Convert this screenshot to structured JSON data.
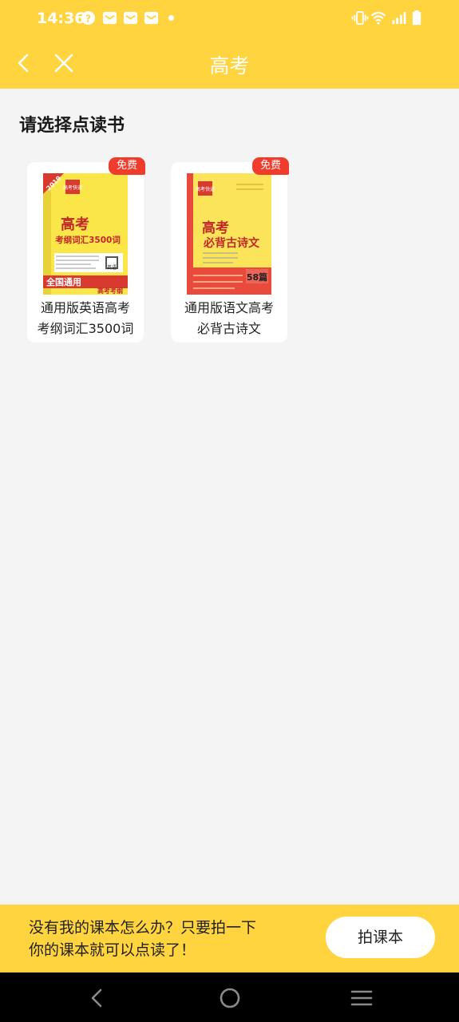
{
  "status_bar": {
    "time": "14:36",
    "icons": [
      "help-circle-icon",
      "mail-icon",
      "mail-icon",
      "mail-icon",
      "notification-dot",
      "vibrate-icon",
      "wifi-icon",
      "signal-icon",
      "battery-icon"
    ]
  },
  "header": {
    "title": "高考",
    "back_icon": "chevron-left-icon",
    "close_icon": "close-icon"
  },
  "section_title": "请选择点读书",
  "books": [
    {
      "badge": "免费",
      "title_line1": "通用版英语高考",
      "title_line2": "考纲词汇3500词",
      "cover": {
        "year": "2019",
        "brand": "高考快递",
        "main_line1": "高考",
        "main_line2": "考纲词汇3500词",
        "bottom_band": "全国通用",
        "bottom_tag": "高考考纲",
        "subject": "英语"
      }
    },
    {
      "badge": "免费",
      "title_line1": "通用版语文高考",
      "title_line2": "必背古诗文",
      "cover": {
        "brand": "高考快递",
        "main_line1": "高考",
        "main_line2": "必背古诗文",
        "count": "58篇"
      }
    }
  ],
  "bottom_bar": {
    "text_line1": "没有我的课本怎么办？只要拍一下",
    "text_line2": "你的课本就可以点读了！",
    "button_label": "拍课本"
  },
  "nav_bar": {
    "back_icon": "nav-back-icon",
    "home_icon": "nav-home-icon",
    "menu_icon": "nav-menu-icon"
  },
  "colors": {
    "accent_yellow": "#ffd43f",
    "badge_red": "#ef3c2d",
    "background": "#f4f4f4"
  }
}
